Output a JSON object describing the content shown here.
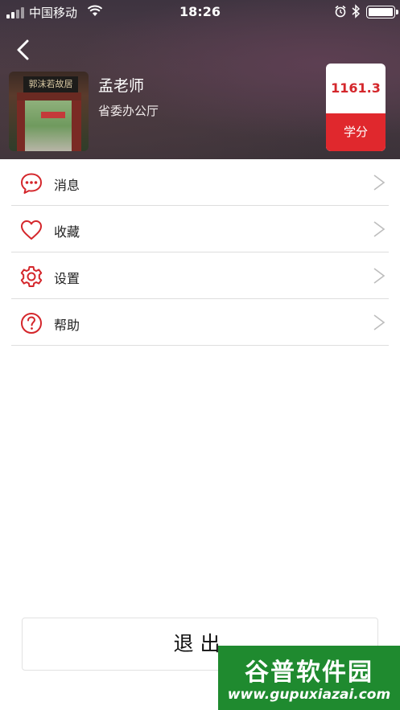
{
  "status_bar": {
    "carrier": "中国移动",
    "time": "18:26"
  },
  "profile": {
    "name": "孟老师",
    "organization": "省委办公厅",
    "avatar_sign_text": "郭沫若故居",
    "score_value": "1161.3",
    "score_label": "学分"
  },
  "menu": {
    "items": [
      {
        "label": "消息",
        "icon": "chat-bubble-icon"
      },
      {
        "label": "收藏",
        "icon": "heart-icon"
      },
      {
        "label": "设置",
        "icon": "gear-icon"
      },
      {
        "label": "帮助",
        "icon": "help-circle-icon"
      }
    ]
  },
  "logout": {
    "label": "退出"
  },
  "watermark": {
    "text": "谷普软件园",
    "url": "www.gupuxiazai.com"
  },
  "colors": {
    "accent": "#e0282d",
    "icon_red": "#d4262b",
    "watermark_green": "#1f8a2f"
  }
}
